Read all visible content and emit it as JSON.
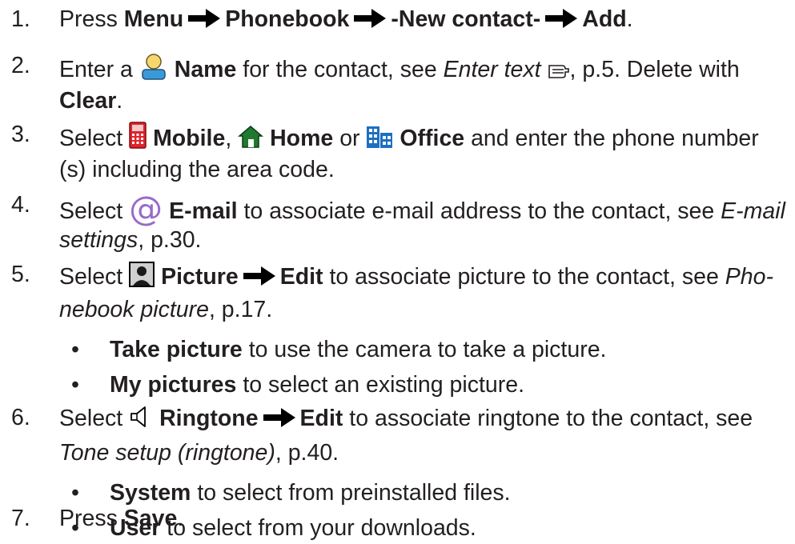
{
  "steps": [
    {
      "number": "1.",
      "press": "Press",
      "menu": "Menu",
      "phonebook": "Phonebook",
      "new_contact": "-New contact-",
      "add": "Add",
      "period": "."
    },
    {
      "number": "2.",
      "enter_a": "Enter a",
      "name": "Name",
      "for_contact": "for the contact, see",
      "enter_text": "Enter text",
      "page": ", p.5. Delete with",
      "clear": "Clear",
      "period": "."
    },
    {
      "number": "3.",
      "select": "Select",
      "mobile": "Mobile",
      "comma": ",",
      "home": "Home",
      "or": "or",
      "office": "Office",
      "rest1": "and enter the phone number",
      "rest2": "(s) including the area code."
    },
    {
      "number": "4.",
      "select": "Select",
      "email": "E-mail",
      "rest1": "to associate e-mail address to the contact, see",
      "email_link1": "E-mail",
      "email_link2": "settings",
      "page": ", p.30."
    },
    {
      "number": "5.",
      "select": "Select",
      "picture": "Picture",
      "edit": "Edit",
      "rest1": "to associate picture to the contact, see",
      "link1": "Pho-",
      "link2": "nebook picture",
      "page": ", p.17.",
      "subitems": [
        {
          "bullet": "•",
          "bold": "Take picture",
          "text": "to use the camera to take a picture."
        },
        {
          "bullet": "•",
          "bold": "My pictures",
          "text": "to select an existing picture."
        }
      ]
    },
    {
      "number": "6.",
      "select": "Select",
      "ringtone": "Ringtone",
      "edit": "Edit",
      "rest1": "to associate ringtone to the contact, see",
      "link": "Tone setup (ringtone)",
      "page": ", p.40.",
      "subitems": [
        {
          "bullet": "•",
          "bold": "System",
          "text": "to select from preinstalled files."
        },
        {
          "bullet": "•",
          "bold": "User",
          "text": "to select from your downloads."
        }
      ]
    },
    {
      "number": "7.",
      "press": "Press",
      "save": "Save",
      "period": "."
    }
  ],
  "icons": {
    "arrow": "right-arrow-icon",
    "name": "person-icon",
    "enter_text_ref": "pointing-hand-icon",
    "mobile": "mobile-phone-icon",
    "home": "home-icon",
    "office": "office-building-icon",
    "email": "at-sign-icon",
    "picture": "portrait-icon",
    "ringtone": "speaker-icon"
  },
  "colors": {
    "text": "#231f20",
    "mobile_red": "#e0242b",
    "home_green": "#1f7a2e",
    "office_blue": "#1e6fc0",
    "at_purple": "#9a6ac8"
  }
}
